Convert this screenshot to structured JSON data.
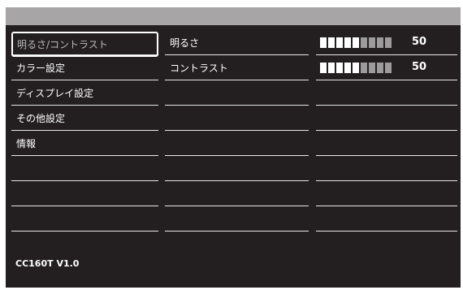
{
  "menu": {
    "items": [
      {
        "label": "明るさ/コントラスト",
        "selected": true
      },
      {
        "label": "カラー設定"
      },
      {
        "label": "ディスプレイ設定"
      },
      {
        "label": "その他設定"
      },
      {
        "label": "情報"
      },
      {
        "label": ""
      },
      {
        "label": ""
      },
      {
        "label": ""
      }
    ]
  },
  "settings": [
    {
      "label": "明るさ",
      "value": "50",
      "level": 0.5
    },
    {
      "label": "コントラスト",
      "value": "50",
      "level": 0.5
    }
  ],
  "footer": {
    "version": "CC160T V1.0"
  },
  "colors": {
    "background": "#231f20",
    "titlebar": "#a7a5a6",
    "bar_on": "#ffffff",
    "bar_off": "#9d9b9c"
  }
}
